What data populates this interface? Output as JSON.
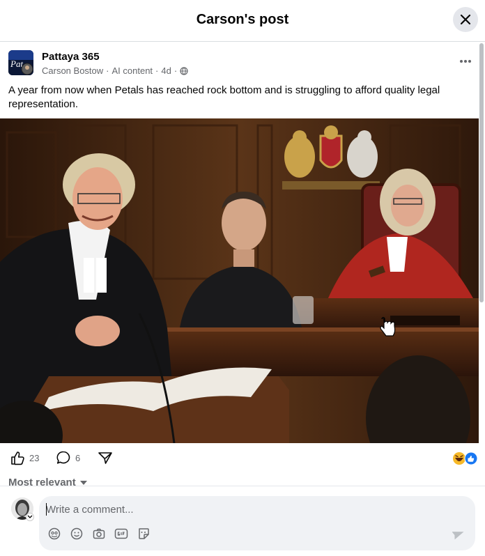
{
  "dialog": {
    "title": "Carson's post"
  },
  "post": {
    "page_name": "Pattaya 365",
    "author": "Carson Bostow",
    "label": "AI content",
    "age": "4d",
    "separator": "·",
    "text": "A year from now when Petals has reached rock bottom and is struggling to afford quality legal representation.",
    "avatar_text": "Pat"
  },
  "stats": {
    "likes": "23",
    "comments": "6"
  },
  "comments": {
    "sort_label": "Most relevant",
    "placeholder": "Write a comment..."
  },
  "icons": {
    "close": "close-icon",
    "more": "more-options-icon",
    "audience": "globe-icon",
    "like": "thumbs-up-icon",
    "comment": "comment-bubble-icon",
    "share": "share-icon",
    "reaction_haha": "haha-reaction-icon",
    "reaction_like": "like-reaction-icon",
    "avatar_frame": "avatar-frame-icon",
    "emoji": "emoji-icon",
    "camera": "camera-icon",
    "gif": "gif-icon",
    "sticker": "sticker-icon",
    "send": "send-icon"
  },
  "colors": {
    "accent": "#1877f2",
    "secondary_text": "#65676b",
    "input_bg": "#f0f2f5"
  }
}
